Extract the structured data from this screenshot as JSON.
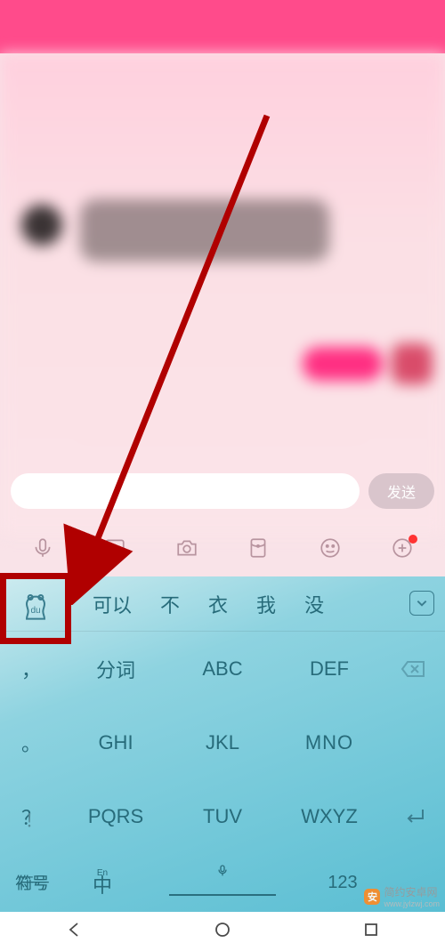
{
  "input": {
    "send_label": "发送"
  },
  "tools": {
    "voice": "voice-icon",
    "image": "image-icon",
    "camera": "camera-icon",
    "redpacket": "redpacket-icon",
    "emoji": "emoji-icon",
    "plus": "plus-icon"
  },
  "keyboard": {
    "candidates": [
      "可以",
      "不",
      "衣",
      "我",
      "没"
    ],
    "side": {
      "r1": "，",
      "r2": "。",
      "r3": "？",
      "r4": "！"
    },
    "keys": {
      "k1": "分词",
      "k2": "ABC",
      "k3": "DEF",
      "k4": "GHI",
      "k5": "JKL",
      "k6": "MNO",
      "k7": "PQRS",
      "k8": "TUV",
      "k9": "WXYZ"
    },
    "bottom": {
      "symbol": "符号",
      "lang_small": "En",
      "lang_main": "中",
      "num": "123"
    }
  },
  "watermark": {
    "text": "简约安卓网",
    "url": "www.jylzwj.com"
  }
}
